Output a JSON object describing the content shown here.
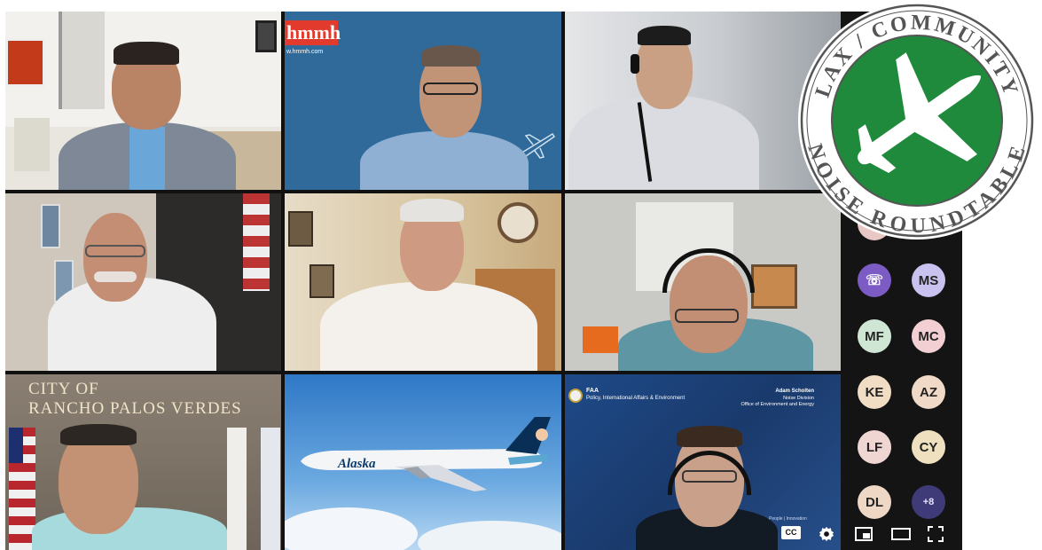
{
  "logo": {
    "text_top": "LAX / COMMUNITY",
    "text_bottom": "NOISE ROUNDTABLE"
  },
  "tiles": {
    "hmmh": {
      "brand": "hmmh",
      "url": "w.hmmh.com"
    },
    "rpv": {
      "line1": "CITY OF",
      "line2": "RANCHO PALOS VERDES"
    },
    "plane": {
      "livery": "Alaska"
    },
    "faa": {
      "agency": "FAA",
      "office": "Policy, International Affairs & Environment",
      "speaker_name": "Adam Scholten",
      "speaker_division": "Noise Division",
      "speaker_office": "Office of Environment and Energy",
      "footer": "People | Innovation"
    }
  },
  "participants": [
    {
      "initials": "",
      "color": "#7c5cc4"
    },
    {
      "initials": "MS",
      "color": "#c9c2ef"
    },
    {
      "initials": "MF",
      "color": "#cfe6d4"
    },
    {
      "initials": "MC",
      "color": "#f1cfd3"
    },
    {
      "initials": "KE",
      "color": "#f1dcc4"
    },
    {
      "initials": "AZ",
      "color": "#f1d9c8"
    },
    {
      "initials": "LF",
      "color": "#f0d6d3"
    },
    {
      "initials": "CY",
      "color": "#efe0bf"
    },
    {
      "initials": "DL",
      "color": "#efd7c6"
    },
    {
      "initials": "+8",
      "color": "#3f3a78"
    }
  ],
  "controls": {
    "cc": "CC",
    "icons": [
      "captions-icon",
      "settings-icon",
      "miniplayer-icon",
      "theater-icon",
      "fullscreen-icon"
    ]
  },
  "colors": {
    "logo_green": "#1f8a3c",
    "strip_bg": "#141414",
    "faa_blue": "#1b3d74"
  }
}
